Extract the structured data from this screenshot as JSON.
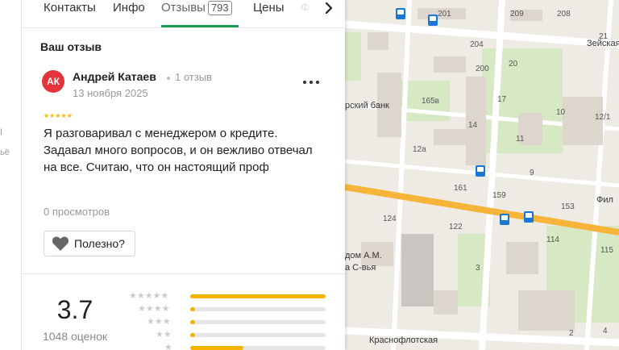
{
  "left_strip": {
    "text1": "I",
    "text2": "ьё"
  },
  "tabs": [
    {
      "label": "Контакты"
    },
    {
      "label": "Инфо"
    },
    {
      "label": "Отзывы",
      "count": "793"
    },
    {
      "label": "Цены"
    },
    {
      "label": "Ф"
    }
  ],
  "review_section": {
    "title": "Ваш отзыв",
    "avatar_initials": "АК",
    "author": "Андрей Катаев",
    "author_reviews": "1 отзыв",
    "date": "13 ноября 2025",
    "stars": 5,
    "text": "Я разговаривал с менеджером о кредите. Задавал много вопросов, и он вежливо отвечал на все. Считаю, что он настоящий проф",
    "views": "0 просмотров",
    "helpful_label": "Полезно?"
  },
  "rating": {
    "value": "3.7",
    "count_label": "1048 оценок",
    "distribution": [
      {
        "stars": 5,
        "fraction": 1.0
      },
      {
        "stars": 4,
        "fraction": 0.03
      },
      {
        "stars": 3,
        "fraction": 0.03
      },
      {
        "stars": 2,
        "fraction": 0.03
      },
      {
        "stars": 1,
        "fraction": 0.39
      }
    ]
  },
  "colors": {
    "accent": "#1a9b52",
    "star": "#fdb500",
    "bar": "#f4b400",
    "avatar": "#e6343c",
    "road": "#f7b43a"
  },
  "map": {
    "streets": [
      {
        "label": "Зейская"
      },
      {
        "label": "Краснофлотская"
      },
      {
        "label": "Фил"
      }
    ],
    "places": [
      {
        "label": "рский банк"
      },
      {
        "label": "дом А.М."
      },
      {
        "label": "а С-вья"
      }
    ],
    "house_numbers": [
      "209",
      "201",
      "208",
      "21",
      "204",
      "200",
      "165в",
      "20",
      "17",
      "14",
      "12а",
      "11",
      "10",
      "12/1",
      "161",
      "159",
      "9",
      "153",
      "124",
      "122",
      "114",
      "115",
      "3",
      "2",
      "4"
    ]
  }
}
